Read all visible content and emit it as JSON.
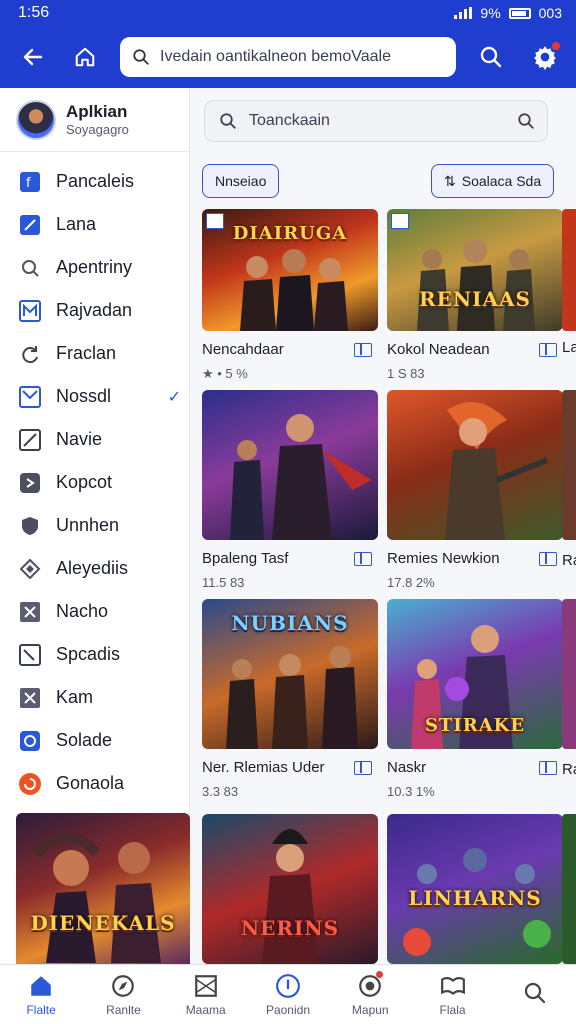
{
  "status_bar": {
    "time": "1:56",
    "battery_text": "9%",
    "extra": "003"
  },
  "app_bar": {
    "search_placeholder": "Ivedain oantikalneon bemoVaale"
  },
  "profile": {
    "name": "Aplkian",
    "subtitle": "Soyagagro"
  },
  "sidebar": {
    "items": [
      {
        "label": "Pancaleis",
        "icon": "f-square-icon"
      },
      {
        "label": "Lana",
        "icon": "pencil-square-icon"
      },
      {
        "label": "Apentriny",
        "icon": "gear-leaf-icon"
      },
      {
        "label": "Rajvadan",
        "icon": "m-square-icon"
      },
      {
        "label": "Fraclan",
        "icon": "refresh-icon"
      },
      {
        "label": "Nossdl",
        "icon": "envelope-square-icon",
        "checked": true
      },
      {
        "label": "Navie",
        "icon": "crossed-square-icon"
      },
      {
        "label": "Kopcot",
        "icon": "arrow-square-icon"
      },
      {
        "label": "Unnhen",
        "icon": "shield-icon"
      },
      {
        "label": "Aleyediis",
        "icon": "diamond-icon"
      },
      {
        "label": "Nacho",
        "icon": "x-square-icon"
      },
      {
        "label": "Spcadis",
        "icon": "check-square-icon"
      },
      {
        "label": "Kam",
        "icon": "x-box-icon"
      },
      {
        "label": "Solade",
        "icon": "clock-square-icon"
      },
      {
        "label": "Gonaola",
        "icon": "orange-circle-icon"
      }
    ],
    "banner_title": "DIENEKALS"
  },
  "main": {
    "search_placeholder": "Toanckaain",
    "chip_left": "Nnseiao",
    "chip_right": "Soalaca Sda",
    "cards": [
      {
        "title": "Nencahdaar",
        "meta": "★ • 5 %",
        "art_title": "DIAIRUGA"
      },
      {
        "title": "Kokol Neadean",
        "meta": "1 S 83",
        "art_title": "RENIAAS"
      },
      {
        "title": "Bpaleng Tasf",
        "meta": "11.5 83",
        "art_title": ""
      },
      {
        "title": "Remies Newkion",
        "meta": "17.8 2%",
        "art_title": ""
      },
      {
        "title": "Ner. Rlemias Uder",
        "meta": "3.3 83",
        "art_title": "NUBIANS"
      },
      {
        "title": "Naskr",
        "meta": "10.3 1%",
        "art_title": "STIRAKE"
      },
      {
        "title": "",
        "meta": "",
        "art_title": "NERINS"
      },
      {
        "title": "",
        "meta": "",
        "art_title": "LINHARNS"
      }
    ],
    "partial_column": [
      "La",
      "Ra",
      "Ra"
    ]
  },
  "bottom_nav": [
    {
      "label": "Flalte",
      "icon": "home-icon",
      "active": true
    },
    {
      "label": "Ranlte",
      "icon": "compass-icon"
    },
    {
      "label": "Maama",
      "icon": "image-icon"
    },
    {
      "label": "Paonidn",
      "icon": "info-circle-icon"
    },
    {
      "label": "Mapun",
      "icon": "target-icon"
    },
    {
      "label": "Flala",
      "icon": "book-icon"
    },
    {
      "label": "",
      "icon": "search-icon"
    }
  ],
  "colors": {
    "brand": "#1f3ecf",
    "accent": "#2b58d9"
  }
}
